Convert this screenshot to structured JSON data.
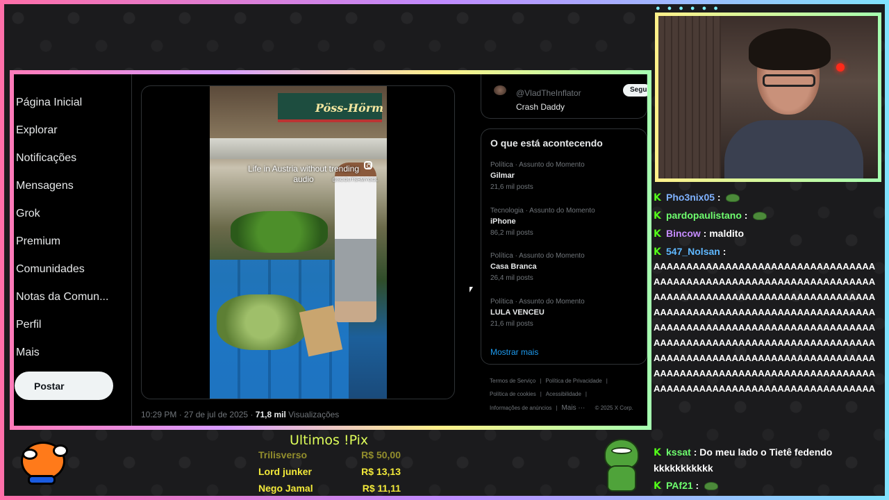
{
  "twitter": {
    "nav": [
      "Página Inicial",
      "Explorar",
      "Notificações",
      "Mensagens",
      "Grok",
      "Premium",
      "Comunidades",
      "Notas da Comun...",
      "Perfil",
      "Mais"
    ],
    "post_button": "Postar",
    "video": {
      "caption": "Life in Austria without trending audio",
      "handle": "@SCOUTSHMYGOL",
      "sign_text": "Pöss-Hörm"
    },
    "tweet_meta": {
      "time": "10:29 PM · 27 de jul de 2025 · ",
      "views": "71,8 mil",
      "views_label": " Visualizações"
    },
    "follow_card": {
      "handle": "@VladTheInflator",
      "name": "Crash Daddy",
      "button": "Seguir"
    },
    "trends": {
      "title": "O que está acontecendo",
      "items": [
        {
          "meta": "Política · Assunto do Momento",
          "name": "Gilmar",
          "count": "21,6 mil posts"
        },
        {
          "meta": "Tecnologia · Assunto do Momento",
          "name": "iPhone",
          "count": "86,2 mil posts"
        },
        {
          "meta": "Política · Assunto do Momento",
          "name": "Casa Branca",
          "count": "26,4 mil posts"
        },
        {
          "meta": "Política · Assunto do Momento",
          "name": "LULA VENCEU",
          "count": "21,6 mil posts"
        }
      ],
      "show_more": "Mostrar mais"
    },
    "footer": {
      "terms": "Termos de Serviço",
      "privacy": "Política de Privacidade",
      "cookies": "Política de cookies",
      "accessibility": "Acessibilidade",
      "ads": "Informações de anúncios",
      "more": "Mais ···",
      "copyright": "© 2025 X Corp."
    }
  },
  "chat": {
    "messages": [
      {
        "user": "Pho3nix05",
        "text": " : ",
        "color": "#7fb2ff",
        "emote": true
      },
      {
        "user": "pardopaulistano",
        "text": " : ",
        "color": "#6fff6f",
        "emote": true
      },
      {
        "user": "Bincow",
        "text": " : maldito",
        "color": "#c68cff",
        "emote": false
      },
      {
        "user": "547_Nolsan",
        "text": " :",
        "color": "#5fb8ff",
        "emote": false
      }
    ],
    "spam": "AAAAAAAAAAAAAAAAAAAAAAAAAAAAAAAAAAAAAAAAAAAAAAAAAAAAAAAAAAAAAAAAAAAAAAAAAAAAAAAAAAAAAAAAAAAAAAAAAAAAAAAAAAAAAAAAAAAAAAAAAAAAAAAAAAAAAAAAAAAAAAAAAAAAAAAAAAAAAAAAAAAAAAAAAAAAAAAAAAAAAAAAAAAAAAAAAAAAAAAAAAAAAAAAAAAAAAAAAAAAAAAAAAAAAAAAAAAAAAAAAAAAAAAAAAAAAAAAAAAAAAAAAAAAAAAAAAAAAAAAAAAAAAAAAAAAAAAAAAAAAAAAAA",
    "later": [
      {
        "user": "kssat",
        "text": " : Do meu lado o Tietê fedendo kkkkkkkkkkk",
        "color": "#6fff6f",
        "emote": false
      },
      {
        "user": "PAf21",
        "text": " : ",
        "color": "#6fff6f",
        "emote": true
      }
    ],
    "badge": "K"
  },
  "pix": {
    "title": "Ultimos !Pix",
    "rows": [
      {
        "name": "Trilisverso",
        "amount": "R$ 50,00"
      },
      {
        "name": "Lord junker",
        "amount": "R$ 13,13"
      },
      {
        "name": "Nego Jamal",
        "amount": "R$ 11,11"
      }
    ]
  }
}
